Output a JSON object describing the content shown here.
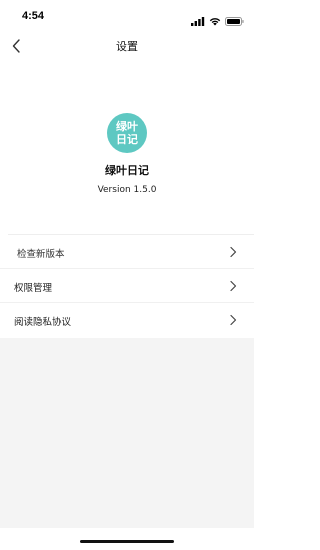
{
  "status_bar": {
    "time": "4:54",
    "icons": [
      "signal-icon",
      "wifi-icon",
      "battery-icon"
    ]
  },
  "nav": {
    "title": "设置",
    "back_icon": "chevron-left-icon"
  },
  "app": {
    "logo_text_line1": "绿叶",
    "logo_text_line2": "日记",
    "logo_color": "#5ec8c2",
    "name": "绿叶日记",
    "version": "Version 1.5.0"
  },
  "settings": {
    "items": [
      {
        "label": "检查新版本",
        "icon": "chevron-right-icon"
      },
      {
        "label": "权限管理",
        "icon": "chevron-right-icon"
      },
      {
        "label": "阅读隐私协议",
        "icon": "chevron-right-icon"
      }
    ]
  },
  "colors": {
    "background": "#ffffff",
    "gray_area": "#f4f4f4"
  }
}
